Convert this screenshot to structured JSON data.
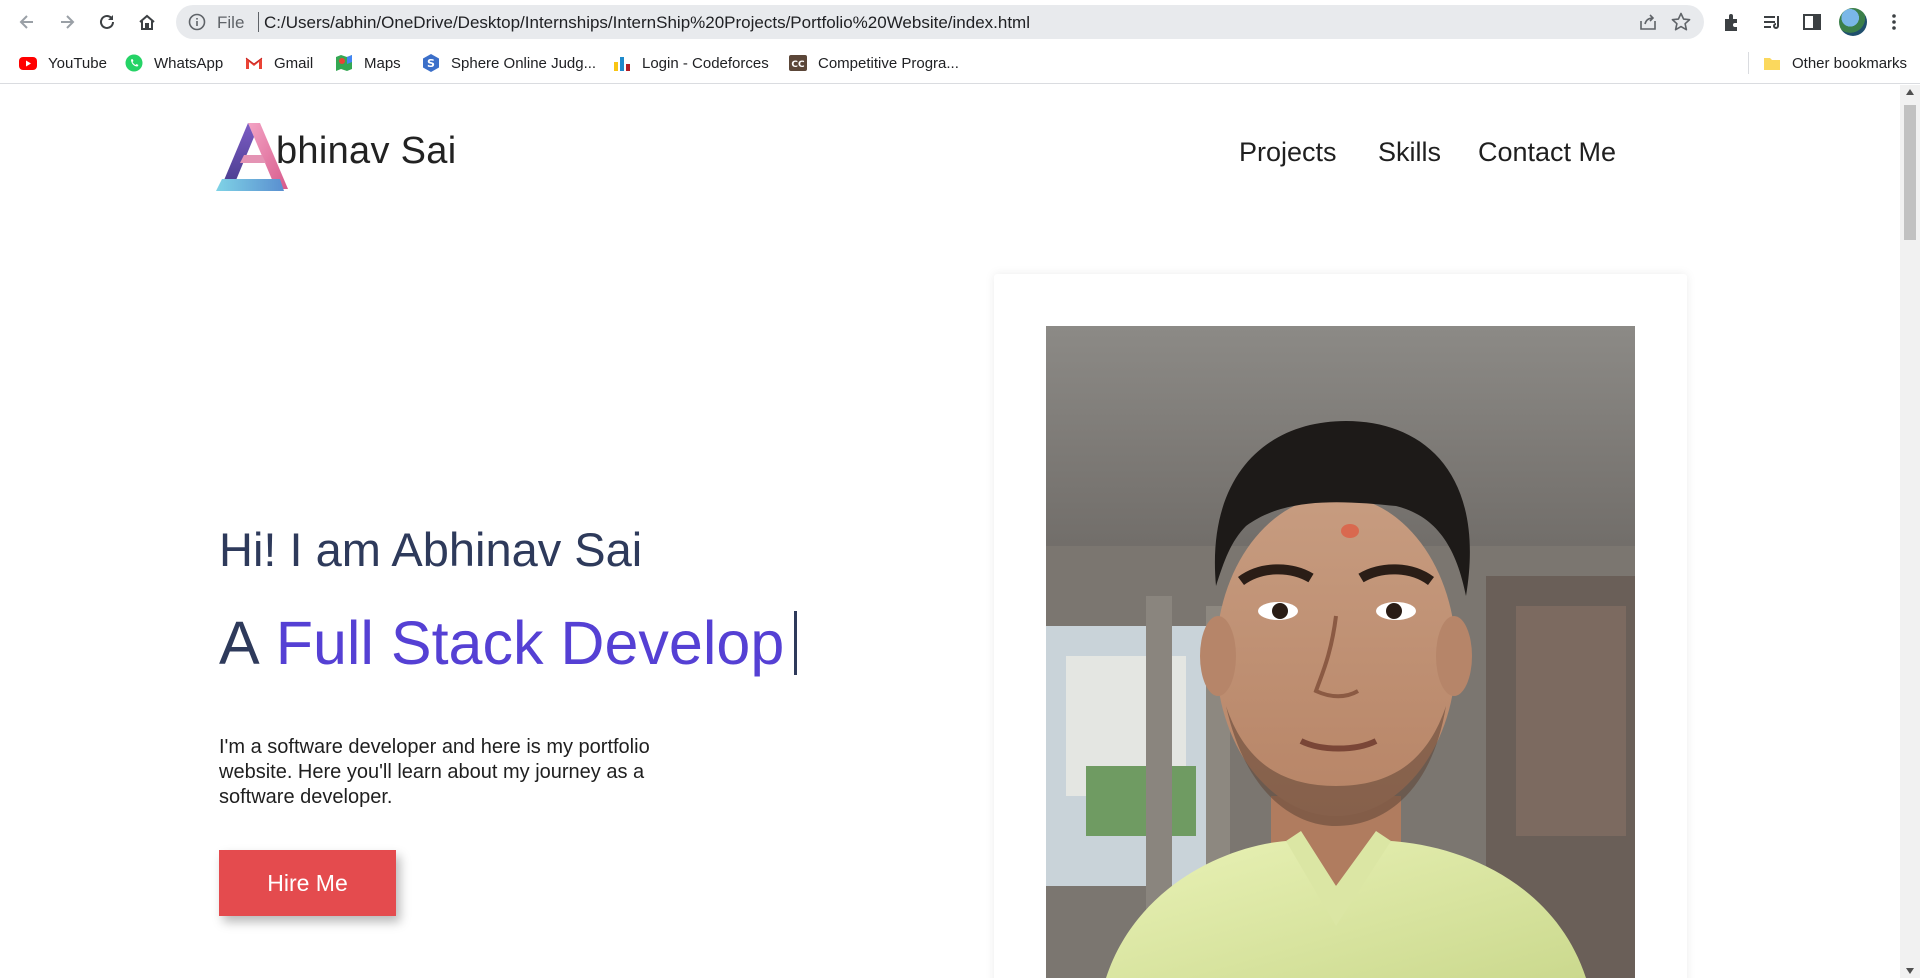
{
  "browser": {
    "url_scheme": "File",
    "url": "C:/Users/abhin/OneDrive/Desktop/Internships/InternShip%20Projects/Portfolio%20Website/index.html",
    "bookmarks": [
      {
        "label": "YouTube",
        "icon": "youtube-icon"
      },
      {
        "label": "WhatsApp",
        "icon": "whatsapp-icon"
      },
      {
        "label": "Gmail",
        "icon": "gmail-icon"
      },
      {
        "label": "Maps",
        "icon": "maps-icon"
      },
      {
        "label": "Sphere Online Judg...",
        "icon": "spoj-icon"
      },
      {
        "label": "Login - Codeforces",
        "icon": "codeforces-icon"
      },
      {
        "label": "Competitive Progra...",
        "icon": "codechef-icon"
      }
    ],
    "other_bookmarks": "Other bookmarks"
  },
  "page": {
    "brand": "bhinav Sai",
    "nav": [
      "Projects",
      "Skills",
      "Contact Me"
    ],
    "greeting": "Hi! I am Abhinav Sai",
    "role_prefix": "A",
    "role_typed": "Full Stack Develop",
    "intro": "I'm a software developer and here is my portfolio website. Here you'll learn about my journey as a software developer.",
    "hire_button": "Hire Me",
    "colors": {
      "accent": "#5540d4",
      "heading": "#2e3a5b",
      "button": "#e44b4e"
    }
  }
}
